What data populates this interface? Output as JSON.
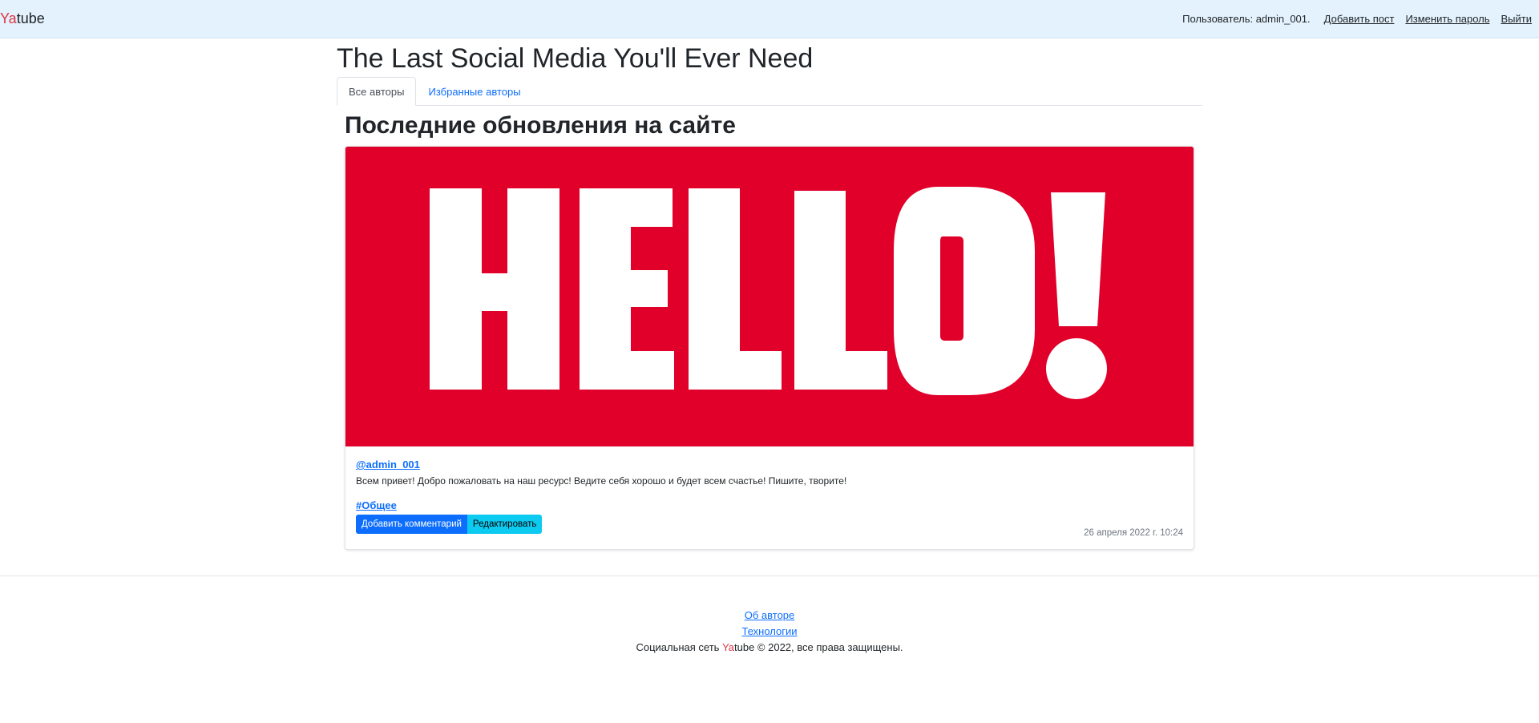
{
  "navbar": {
    "brand_ya": "Ya",
    "brand_tube": "tube",
    "user_text": "Пользователь: admin_001.",
    "add_post": "Добавить пост",
    "change_password": "Изменить пароль",
    "logout": "Выйти",
    "background_color": "#e3f2fd"
  },
  "header": {
    "site_title": "The Last Social Media You'll Ever Need"
  },
  "tabs": [
    {
      "label": "Все авторы",
      "active": true
    },
    {
      "label": "Избранные авторы",
      "active": false
    }
  ],
  "main": {
    "heading": "Последние обновления на сайте"
  },
  "post": {
    "image_text": "HELLO!",
    "image_background": "#e0002a",
    "author": "@admin_001",
    "text": "Всем привет! Добро пожаловать на наш ресурс! Ведите себя хорошо и будет всем счастье! Пишите, творите!",
    "group": "#Общее",
    "add_comment_label": "Добавить комментарий",
    "edit_label": "Редактировать",
    "date": "26 апреля 2022 г. 10:24"
  },
  "footer": {
    "about_author": "Об авторе",
    "technologies": "Технологии",
    "copyright_prefix": "Социальная сеть ",
    "copyright_ya": "Ya",
    "copyright_suffix": "tube © 2022, все права защищены."
  },
  "colors": {
    "accent": "#0d6efd",
    "info": "#0dcaf0",
    "brand_red": "#dc3545"
  }
}
